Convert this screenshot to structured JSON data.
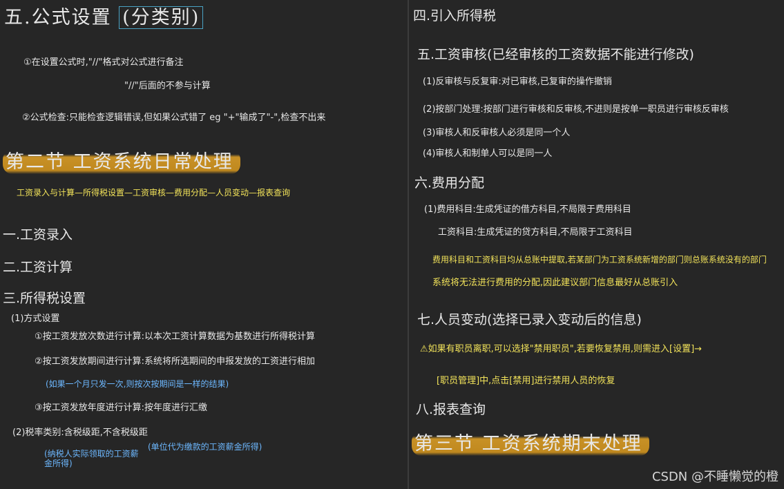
{
  "left": {
    "section5_title": "五.公式设置",
    "section5_box": "(分类别)",
    "l5_1": "①在设置公式时,\"//\"格式对公式进行备注",
    "l5_2": "\"//\"后面的不参与计算",
    "l5_3": "②公式检查:只能检查逻辑错误,但如果公式错了 eg \"+\"输成了\"-\",检查不出来",
    "ch2_title": "第二节 工资系统日常处理",
    "ch2_flow": "工资录入与计算—所得税设置—工资审核—费用分配—人员变动—报表查询",
    "s1": "一.工资录入",
    "s2": "二.工资计算",
    "s3": "三.所得税设置",
    "s3_1": "(1)方式设置",
    "s3_1a": "①按工资发放次数进行计算:以本次工资计算数据为基数进行所得税计算",
    "s3_1b": "②按工资发放期间进行计算:系统将所选期间的申报发放的工资进行相加",
    "s3_1b_note": "(如果一个月只发一次,则按次按期间是一样的结果)",
    "s3_1c": "③按工资发放年度进行计算:按年度进行汇缴",
    "s3_2": "(2)税率类别:含税级距,不含税级距",
    "s3_2_note1": "(纳税人实际领取的工资薪金所得)",
    "s3_2_note2": "(单位代为缴款的工资薪金所得)"
  },
  "right": {
    "s4": "四.引入所得税",
    "s5": "五.工资审核(已经审核的工资数据不能进行修改)",
    "s5_1": "(1)反审核与反复审:对已审核,已复审的操作撤销",
    "s5_2": "(2)按部门处理:按部门进行审核和反审核,不进则是按单一职员进行审核反审核",
    "s5_3": "(3)审核人和反审核人必须是同一个人",
    "s5_4": "(4)审核人和制单人可以是同一人",
    "s6": "六.费用分配",
    "s6_1": "(1)费用科目:生成凭证的借方科目,不局限于费用科目",
    "s6_2": "工资科目:生成凭证的贷方科目,不局限于工资科目",
    "s6_3": "费用科目和工资科目均从总账中提取,若某部门为工资系统新增的部门则总账系统没有的部门",
    "s6_4": "系统将无法进行费用的分配,因此建议部门信息最好从总账引入",
    "s7": "七.人员变动(选择已录入变动后的信息)",
    "s7_1": "⚠如果有职员离职,可以选择\"禁用职员\",若要恢复禁用,则需进入[设置]→",
    "s7_2": "[职员管理]中,点击[禁用]进行禁用人员的恢复",
    "s8": "八.报表查询",
    "ch3_title": "第三节 工资系统期末处理"
  },
  "watermark": "CSDN @不睡懒觉的橙",
  "colors": {
    "background": "#262626",
    "highlight": "#d69a26",
    "yellow_ink": "#f2e35a",
    "blue_ink": "#6db8ff",
    "box_border": "#4aa3c4"
  }
}
